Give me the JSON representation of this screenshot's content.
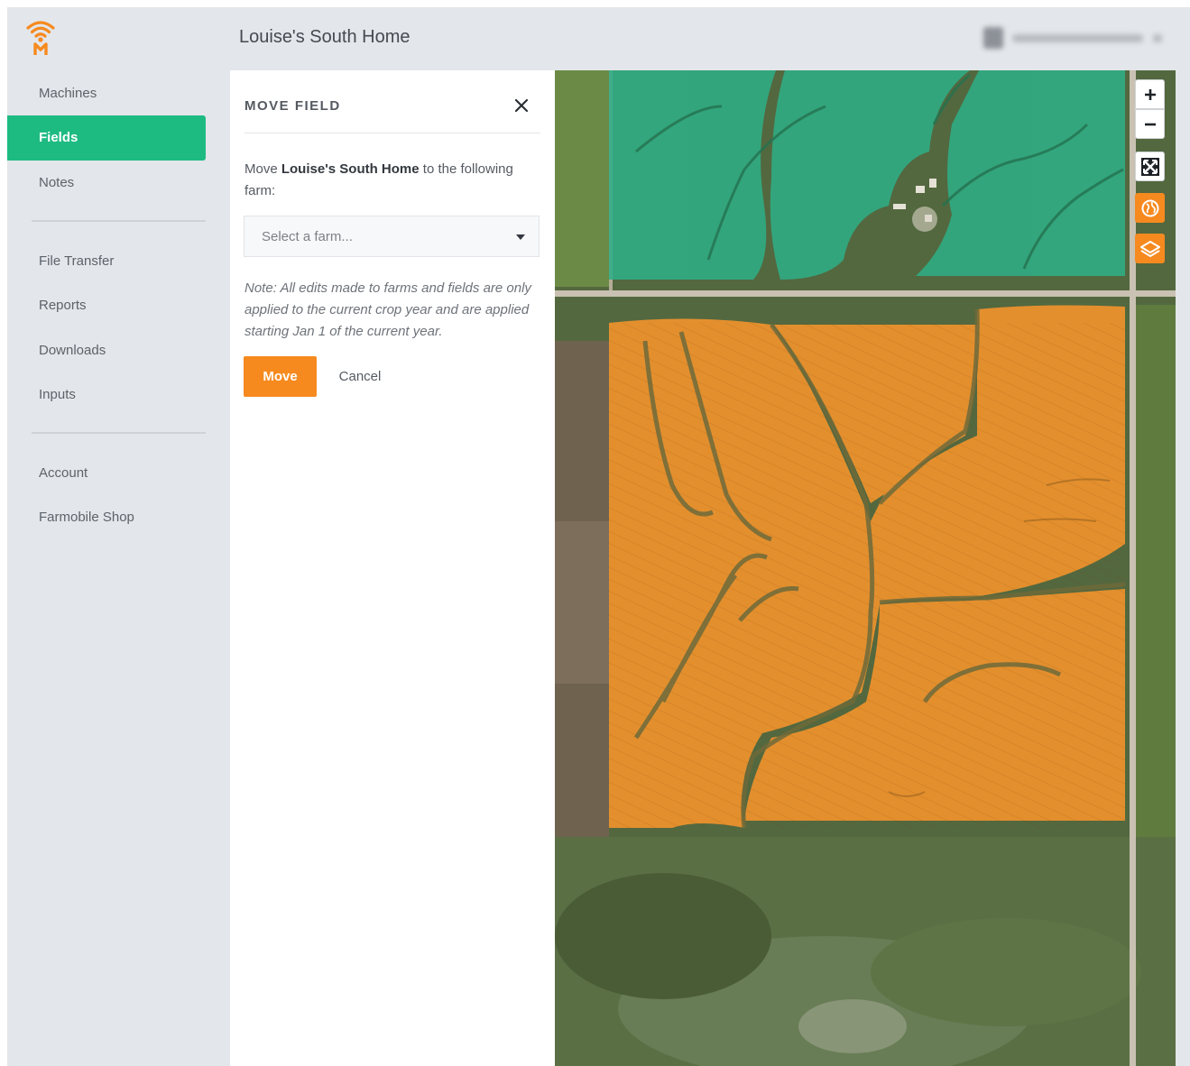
{
  "app": {
    "logo_icon": "farmobile-signal-logo",
    "accent_color": "#f68a1f",
    "nav_active_color": "#1dbb82"
  },
  "header": {
    "title": "Louise's South Home"
  },
  "sidebar": {
    "items": [
      {
        "label": "Machines",
        "active": false
      },
      {
        "label": "Fields",
        "active": true
      },
      {
        "label": "Notes",
        "active": false
      },
      {
        "label": "File Transfer",
        "active": false
      },
      {
        "label": "Reports",
        "active": false
      },
      {
        "label": "Downloads",
        "active": false
      },
      {
        "label": "Inputs",
        "active": false
      },
      {
        "label": "Account",
        "active": false
      },
      {
        "label": "Farmobile Shop",
        "active": false
      }
    ]
  },
  "panel": {
    "title": "MOVE FIELD",
    "close_icon": "close-icon",
    "message_prefix": "Move ",
    "message_field": "Louise's South Home",
    "message_suffix": " to the following farm:",
    "select_placeholder": "Select a farm...",
    "note": "Note: All edits made to farms and fields are only applied to the current crop year and are applied starting Jan 1 of the current year.",
    "move_label": "Move",
    "cancel_label": "Cancel"
  },
  "map": {
    "controls": [
      {
        "name": "zoom-in-icon"
      },
      {
        "name": "zoom-out-icon"
      },
      {
        "name": "fullscreen-icon"
      },
      {
        "name": "globe-icon"
      },
      {
        "name": "layers-icon"
      }
    ],
    "field_colors": {
      "other_fields": "#2fae86",
      "selected_field": "#f0922d"
    }
  }
}
